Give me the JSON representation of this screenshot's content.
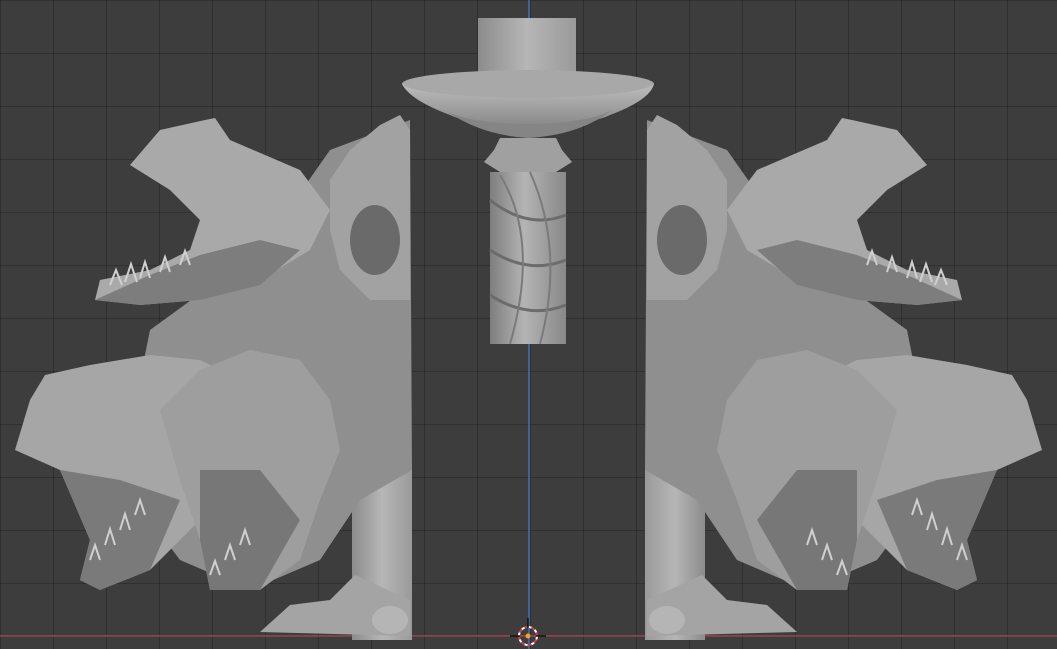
{
  "viewport": {
    "grid_color": "#2f2f2f",
    "background": "#3d3d3d",
    "axis_x_color": "#b04a5a",
    "axis_z_color": "#3f7fd6",
    "mesh_color": "#9a9a9a",
    "mesh_shadow": "#5e5e5e",
    "mesh_highlight": "#c8c8c8"
  },
  "objects": [
    {
      "name": "left-hydra-mesh",
      "icon": "mesh-object"
    },
    {
      "name": "right-hydra-mesh",
      "icon": "mesh-object"
    },
    {
      "name": "center-vase-mesh",
      "icon": "mesh-object"
    }
  ],
  "cursor": {
    "icon": "3d-cursor-icon"
  }
}
